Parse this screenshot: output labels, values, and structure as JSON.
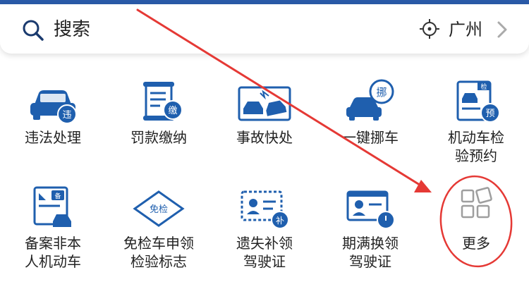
{
  "search": {
    "label": "搜索"
  },
  "location": {
    "city": "广州"
  },
  "items": [
    {
      "lines": [
        "违法处理"
      ],
      "badge": "违"
    },
    {
      "lines": [
        "罚款缴纳"
      ],
      "badge": "缴"
    },
    {
      "lines": [
        "事故快处"
      ],
      "badge": ""
    },
    {
      "lines": [
        "一键挪车"
      ],
      "badge": "挪"
    },
    {
      "lines": [
        "机动车检",
        "验预约"
      ],
      "badge": "预",
      "badge2": "检"
    },
    {
      "lines": [
        "备案非本",
        "人机动车"
      ],
      "badge": "备"
    },
    {
      "lines": [
        "免检车申领",
        "检验标志"
      ],
      "badge": "免检"
    },
    {
      "lines": [
        "遗失补领",
        "驾驶证"
      ],
      "badge": "补"
    },
    {
      "lines": [
        "期满换领",
        "驾驶证"
      ],
      "badge": ""
    },
    {
      "lines": [
        "更多"
      ],
      "badge": ""
    }
  ],
  "colors": {
    "primary": "#1f5fae",
    "accent": "#e53935",
    "muted": "#9e9e9e"
  }
}
